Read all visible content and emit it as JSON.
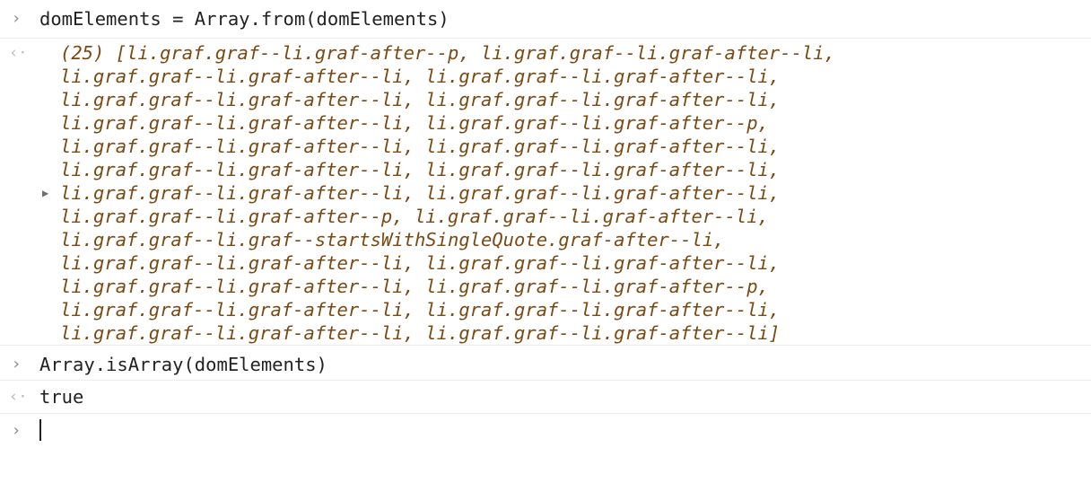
{
  "console": {
    "entries": [
      {
        "prompt_icon": "›",
        "input": "domElements = Array.from(domElements)"
      },
      {
        "result_icon": "‹·",
        "output_lines": [
          "(25) [li.graf.graf--li.graf-after--p, li.graf.graf--li.graf-after--li,",
          "li.graf.graf--li.graf-after--li, li.graf.graf--li.graf-after--li,",
          "li.graf.graf--li.graf-after--li, li.graf.graf--li.graf-after--li,",
          "li.graf.graf--li.graf-after--li, li.graf.graf--li.graf-after--p,",
          "li.graf.graf--li.graf-after--li, li.graf.graf--li.graf-after--li,",
          "li.graf.graf--li.graf-after--li, li.graf.graf--li.graf-after--li,",
          "li.graf.graf--li.graf-after--li, li.graf.graf--li.graf-after--li,",
          "li.graf.graf--li.graf-after--p, li.graf.graf--li.graf-after--li,",
          "li.graf.graf--li.graf--startsWithSingleQuote.graf-after--li,",
          "li.graf.graf--li.graf-after--li, li.graf.graf--li.graf-after--li,",
          "li.graf.graf--li.graf-after--li, li.graf.graf--li.graf-after--p,",
          "li.graf.graf--li.graf-after--li, li.graf.graf--li.graf-after--li,",
          "li.graf.graf--li.graf-after--li, li.graf.graf--li.graf-after--li]"
        ],
        "expand_icon": "▶"
      },
      {
        "prompt_icon": "›",
        "input": "Array.isArray(domElements)"
      },
      {
        "result_icon": "‹·",
        "output": "true"
      },
      {
        "prompt_icon": "›",
        "input": ""
      }
    ]
  },
  "icons": {
    "prompt": "chevron-right-icon",
    "result": "return-arrow-icon",
    "expand": "disclosure-triangle-icon"
  },
  "colors": {
    "output_text": "#7b4a14",
    "input_text": "#222222",
    "prompt_icon": "#8a8a8a",
    "result_icon": "#c4b8a8"
  }
}
